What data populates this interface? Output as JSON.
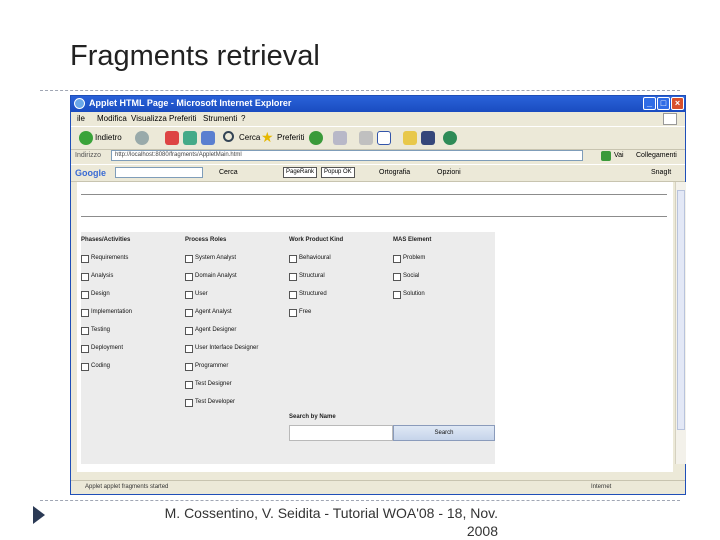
{
  "slide": {
    "title": "Fragments retrieval",
    "footer_line1": "M. Cossentino, V. Seidita - Tutorial WOA'08 - 18, Nov.",
    "footer_line2": "2008"
  },
  "browser": {
    "window_title": "Applet HTML Page - Microsoft Internet Explorer",
    "menu": [
      "ile",
      "Modifica",
      "Visualizza",
      "Preferiti",
      "Strumenti",
      "?"
    ],
    "toolbar": {
      "back": "Indietro",
      "search": "Cerca",
      "favorites": "Preferiti"
    },
    "address": {
      "label": "Indirizzo",
      "value": "http://localhost:8080/fragments/AppletMain.html",
      "go": "Vai",
      "links": "Collegamenti"
    },
    "google_bar": {
      "logo": "Google",
      "search": "Cerca",
      "pagerank": "PageRank",
      "popups": "Popup OK",
      "check": "Ortografia",
      "options": "Opzioni",
      "snagit": "SnagIt"
    },
    "status": {
      "text": "Applet applet fragments started",
      "zone": "Internet"
    }
  },
  "applet": {
    "columns": [
      {
        "header": "Phases/Activities",
        "items": [
          "Requirements",
          "Analysis",
          "Design",
          "Implementation",
          "Testing",
          "Deployment",
          "Coding"
        ]
      },
      {
        "header": "Process Roles",
        "items": [
          "System Analyst",
          "Domain Analyst",
          "User",
          "Agent Analyst",
          "Agent Designer",
          "User Interface Designer",
          "Programmer",
          "Test Designer",
          "Test Developer"
        ]
      },
      {
        "header": "Work Product Kind",
        "items": [
          "Behavioural",
          "Structural",
          "Structured",
          "Free"
        ]
      },
      {
        "header": "MAS Element",
        "items": [
          "Problem",
          "Social",
          "Solution"
        ]
      }
    ],
    "search_label": "Search by Name",
    "search_button": "Search"
  }
}
